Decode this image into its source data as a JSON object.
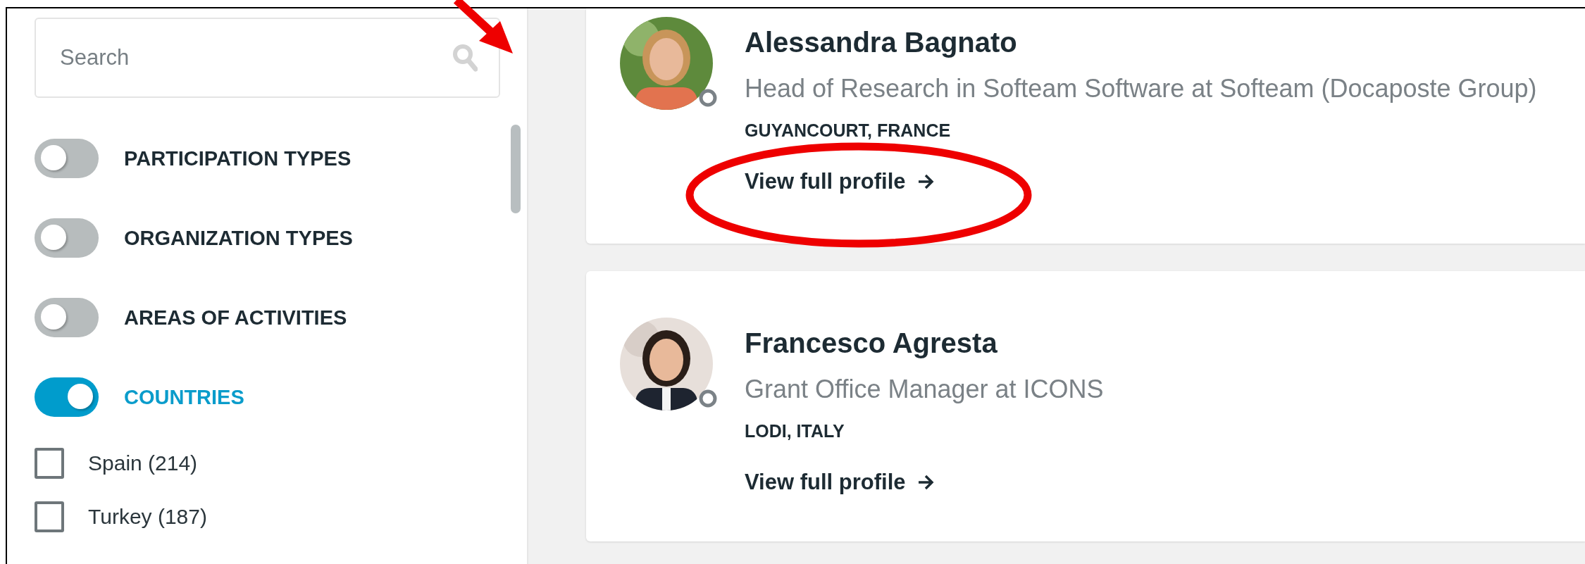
{
  "search": {
    "placeholder": "Search"
  },
  "filters": [
    {
      "label": "PARTICIPATION TYPES",
      "on": false
    },
    {
      "label": "ORGANIZATION TYPES",
      "on": false
    },
    {
      "label": "AREAS OF ACTIVITIES",
      "on": false
    },
    {
      "label": "COUNTRIES",
      "on": true
    }
  ],
  "countries": [
    {
      "label": "Spain (214)",
      "checked": false
    },
    {
      "label": "Turkey (187)",
      "checked": false
    }
  ],
  "profiles": [
    {
      "name": "Alessandra Bagnato",
      "title": "Head of Research in Softeam Software at Softeam (Docaposte Group)",
      "location": "GUYANCOURT, FRANCE",
      "link": "View full profile",
      "circled": true
    },
    {
      "name": "Francesco Agresta",
      "title": "Grant Office Manager at ICONS",
      "location": "LODI, ITALY",
      "link": "View full profile",
      "circled": false
    }
  ],
  "pointer_arrow": true
}
